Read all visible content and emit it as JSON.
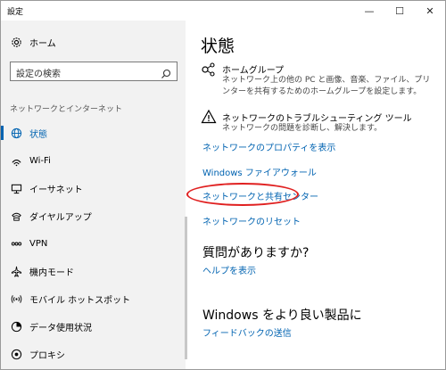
{
  "window": {
    "title": "設定",
    "minimize": "—",
    "maximize": "☐",
    "close": "✕"
  },
  "sidebar": {
    "home_label": "ホーム",
    "search_placeholder": "設定の検索",
    "section_label": "ネットワークとインターネット",
    "items": [
      {
        "label": "状態",
        "icon": "globe-icon",
        "active": true
      },
      {
        "label": "Wi-Fi",
        "icon": "wifi-icon"
      },
      {
        "label": "イーサネット",
        "icon": "ethernet-icon"
      },
      {
        "label": "ダイヤルアップ",
        "icon": "dialup-icon"
      },
      {
        "label": "VPN",
        "icon": "vpn-icon"
      },
      {
        "label": "機内モード",
        "icon": "airplane-icon"
      },
      {
        "label": "モバイル ホットスポット",
        "icon": "hotspot-icon"
      },
      {
        "label": "データ使用状況",
        "icon": "data-usage-icon"
      },
      {
        "label": "プロキシ",
        "icon": "proxy-icon"
      }
    ]
  },
  "main": {
    "title": "状態",
    "homegroup": {
      "title": "ホームグループ",
      "desc": "ネットワーク上の他の PC と画像、音楽、ファイル、プリンターを共有するためのホームグループを設定します。"
    },
    "troubleshoot": {
      "title": "ネットワークのトラブルシューティング ツール",
      "desc": "ネットワークの問題を診断し、解決します。"
    },
    "links": {
      "properties": "ネットワークのプロパティを表示",
      "firewall": "Windows ファイアウォール",
      "sharing_center": "ネットワークと共有センター",
      "reset": "ネットワークのリセット"
    },
    "question_heading": "質問がありますか?",
    "help_link": "ヘルプを表示",
    "improve_heading": "Windows をより良い製品に",
    "feedback_link": "フィードバックの送信"
  },
  "colors": {
    "accent": "#0063b1",
    "highlight": "#e02020"
  }
}
